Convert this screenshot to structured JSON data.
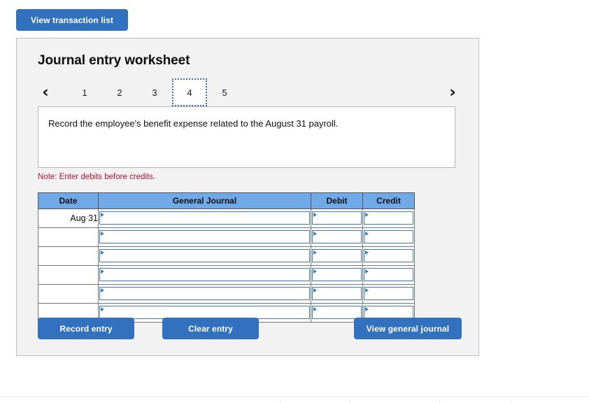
{
  "top_toolbar": {
    "view_transaction_list_label": "View transaction list"
  },
  "panel": {
    "title": "Journal entry worksheet",
    "pager": {
      "prev_icon": "chevron-left-icon",
      "next_icon": "chevron-right-icon",
      "prev_glyph": "‹",
      "next_glyph": "›",
      "pages": [
        "1",
        "2",
        "3",
        "4",
        "5"
      ],
      "active_page": "4"
    },
    "instruction": "Record the employee's benefit expense related to the August 31 payroll.",
    "note": "Note: Enter debits before credits.",
    "note_color": "#b4142b"
  },
  "journal": {
    "headers": [
      "Date",
      "General Journal",
      "Debit",
      "Credit"
    ],
    "rows": [
      {
        "date": "Aug 31",
        "general_journal": "",
        "debit": "",
        "credit": ""
      },
      {
        "date": "",
        "general_journal": "",
        "debit": "",
        "credit": ""
      },
      {
        "date": "",
        "general_journal": "",
        "debit": "",
        "credit": ""
      },
      {
        "date": "",
        "general_journal": "",
        "debit": "",
        "credit": ""
      },
      {
        "date": "",
        "general_journal": "",
        "debit": "",
        "credit": ""
      },
      {
        "date": "",
        "general_journal": "",
        "debit": "",
        "credit": ""
      }
    ],
    "header_bg": "#6fa9e8",
    "input_border": "#3b7cc4"
  },
  "actions": {
    "record_entry_label": "Record entry",
    "clear_entry_label": "Clear entry",
    "view_general_journal_label": "View general journal"
  },
  "colors": {
    "button_blue": "#3171bd",
    "panel_bg": "#f2f2f2",
    "panel_border": "#bfbfbf"
  }
}
